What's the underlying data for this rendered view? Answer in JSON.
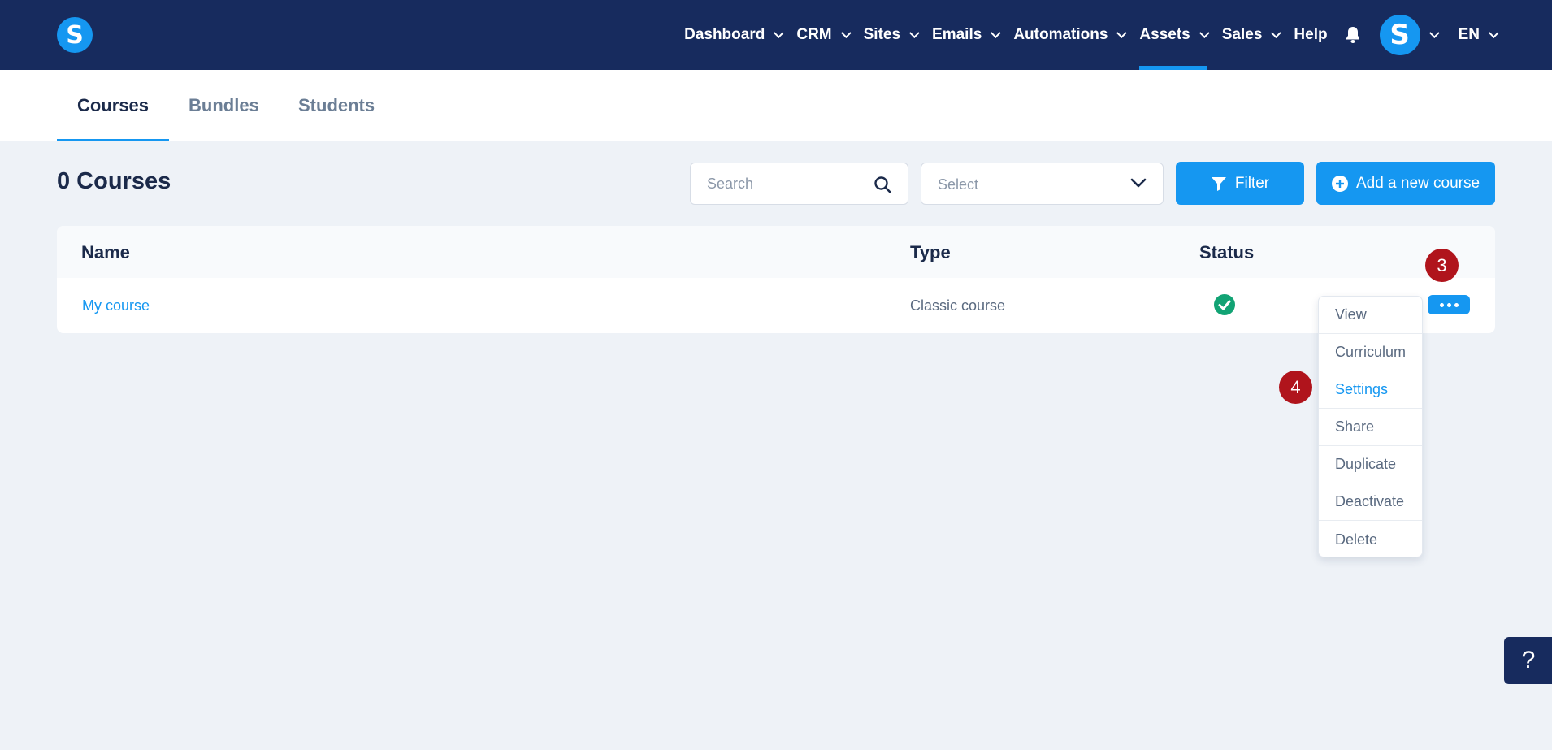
{
  "app": {
    "logo_letter": "S"
  },
  "nav": {
    "items": [
      {
        "label": "Dashboard",
        "has_dropdown": true
      },
      {
        "label": "CRM",
        "has_dropdown": true
      },
      {
        "label": "Sites",
        "has_dropdown": true
      },
      {
        "label": "Emails",
        "has_dropdown": true
      },
      {
        "label": "Automations",
        "has_dropdown": true
      },
      {
        "label": "Assets",
        "has_dropdown": true,
        "active": true
      },
      {
        "label": "Sales",
        "has_dropdown": true
      },
      {
        "label": "Help",
        "has_dropdown": false
      }
    ],
    "avatar_letter": "S",
    "language": "EN"
  },
  "tabs": [
    {
      "label": "Courses",
      "active": true
    },
    {
      "label": "Bundles",
      "active": false
    },
    {
      "label": "Students",
      "active": false
    }
  ],
  "toolbar": {
    "title": "0 Courses",
    "search_placeholder": "Search",
    "select_value": "Select",
    "filter_label": "Filter",
    "add_label": "Add a new course"
  },
  "table": {
    "headers": {
      "name": "Name",
      "type": "Type",
      "status": "Status"
    },
    "rows": [
      {
        "name": "My course",
        "type": "Classic course",
        "status": "active"
      }
    ]
  },
  "menu": {
    "items": [
      "View",
      "Curriculum",
      "Settings",
      "Share",
      "Duplicate",
      "Deactivate",
      "Delete"
    ],
    "highlighted": "Settings"
  },
  "markers": {
    "step3": "3",
    "step4": "4"
  },
  "help_label": "?",
  "colors": {
    "nav_bg": "#172b5e",
    "accent": "#1597f1",
    "success": "#12a374",
    "marker": "#b0141c",
    "page_bg": "#eef2f7"
  }
}
